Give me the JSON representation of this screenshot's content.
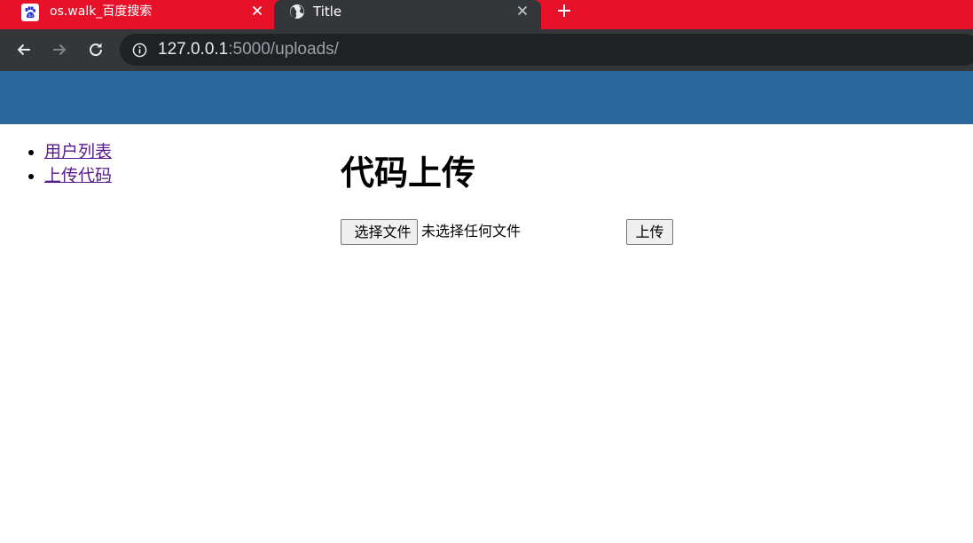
{
  "browser": {
    "tabs": [
      {
        "title": "os.walk_百度搜索",
        "icon": "baidu-paw-icon",
        "active": false
      },
      {
        "title": "Title",
        "icon": "globe-icon",
        "active": true
      }
    ],
    "address_bar": {
      "host": "127.0.0.1",
      "path": ":5000/uploads/"
    },
    "colors": {
      "tab_strip": "#e8112a",
      "toolbar": "#35363a",
      "omnibox": "#202124"
    }
  },
  "page": {
    "header_color": "#2a679b",
    "nav": [
      {
        "label": "用户列表"
      },
      {
        "label": "上传代码"
      }
    ],
    "title": "代码上传",
    "form": {
      "choose_file_label": "选择文件",
      "file_status": "未选择任何文件",
      "upload_label": "上传"
    },
    "link_color": "#551a8b"
  }
}
